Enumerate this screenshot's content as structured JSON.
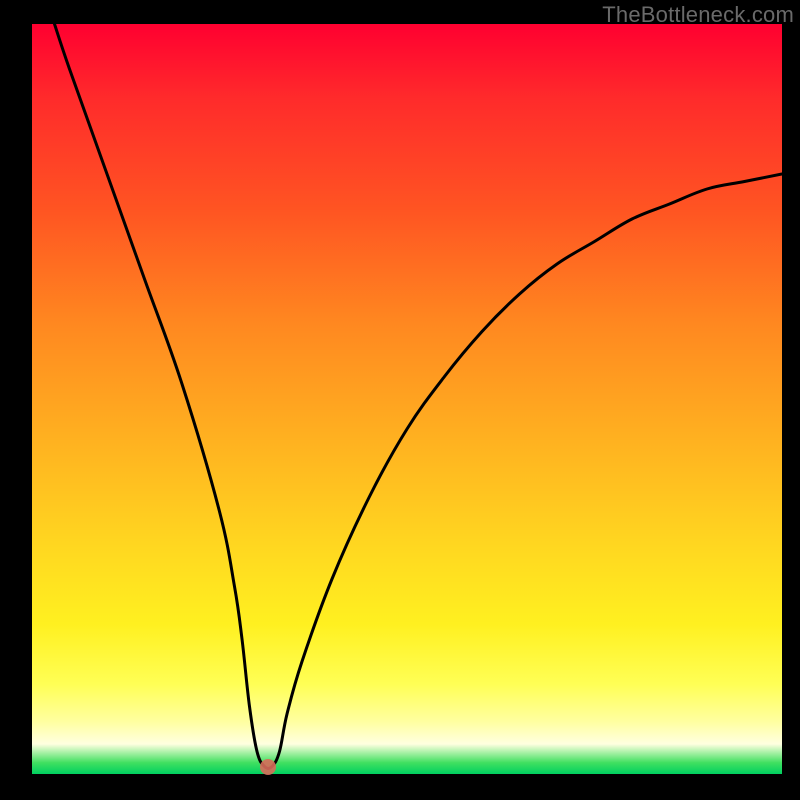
{
  "watermark": "TheBottleneck.com",
  "chart_data": {
    "type": "line",
    "title": "",
    "xlabel": "",
    "ylabel": "",
    "xlim": [
      0,
      100
    ],
    "ylim": [
      0,
      100
    ],
    "x": [
      3,
      5,
      10,
      15,
      20,
      25,
      27,
      28,
      29,
      30,
      31,
      32,
      33,
      34,
      36,
      40,
      45,
      50,
      55,
      60,
      65,
      70,
      75,
      80,
      85,
      90,
      95,
      100
    ],
    "values": [
      100,
      94,
      80,
      66,
      52,
      35,
      25,
      18,
      9,
      3,
      1,
      1,
      3,
      8,
      15,
      26,
      37,
      46,
      53,
      59,
      64,
      68,
      71,
      74,
      76,
      78,
      79,
      80
    ],
    "marker": {
      "x": 31.5,
      "y": 1
    },
    "grid": false,
    "legend": false
  }
}
